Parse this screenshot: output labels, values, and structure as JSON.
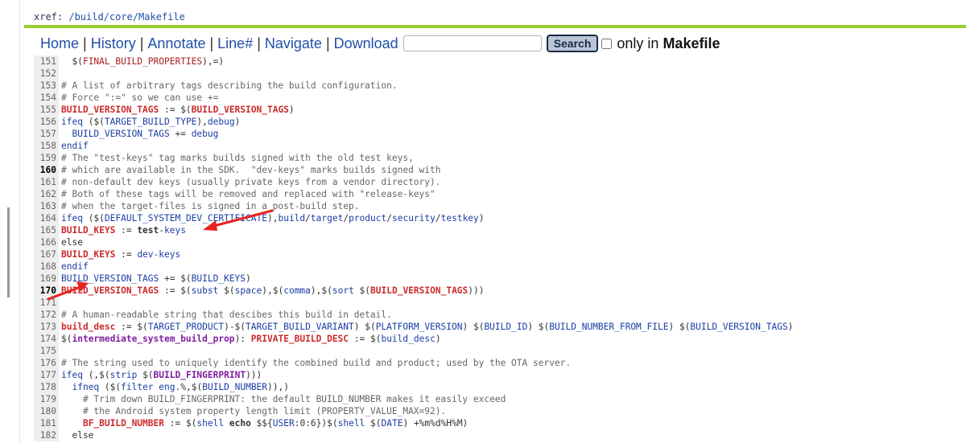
{
  "header": {
    "prefix": "xref:",
    "path": "/build/core/Makefile"
  },
  "nav": {
    "home": "Home",
    "history": "History",
    "annotate": "Annotate",
    "line": "Line#",
    "navigate": "Navigate",
    "download": "Download",
    "sep": "|",
    "search_value": "",
    "search_button": "Search",
    "only_in_prefix": "only in",
    "only_in_file": "Makefile"
  },
  "code": {
    "lines": [
      {
        "n": "151",
        "bold": false,
        "t": [
          [
            "t",
            "  $("
          ],
          [
            "r",
            "FINAL_BUILD_PROPERTIES"
          ],
          [
            "t",
            "),=)"
          ]
        ]
      },
      {
        "n": "152",
        "bold": false,
        "t": []
      },
      {
        "n": "153",
        "bold": false,
        "t": [
          [
            "c",
            "# A list of arbitrary tags describing the build configuration."
          ]
        ]
      },
      {
        "n": "154",
        "bold": false,
        "t": [
          [
            "c",
            "# Force \":=\" so we can use +="
          ]
        ]
      },
      {
        "n": "155",
        "bold": false,
        "t": [
          [
            "v",
            "BUILD_VERSION_TAGS"
          ],
          [
            "t",
            " := $("
          ],
          [
            "v",
            "BUILD_VERSION_TAGS"
          ],
          [
            "t",
            ")"
          ]
        ]
      },
      {
        "n": "156",
        "bold": false,
        "t": [
          [
            "k",
            "ifeq"
          ],
          [
            "t",
            " ($("
          ],
          [
            "b",
            "TARGET_BUILD_TYPE"
          ],
          [
            "t",
            "),"
          ],
          [
            "b",
            "debug"
          ],
          [
            "t",
            ")"
          ]
        ]
      },
      {
        "n": "157",
        "bold": false,
        "t": [
          [
            "t",
            "  "
          ],
          [
            "b",
            "BUILD_VERSION_TAGS"
          ],
          [
            "t",
            " += "
          ],
          [
            "b",
            "debug"
          ]
        ]
      },
      {
        "n": "158",
        "bold": false,
        "t": [
          [
            "k",
            "endif"
          ]
        ]
      },
      {
        "n": "159",
        "bold": false,
        "t": [
          [
            "c",
            "# The \"test-keys\" tag marks builds signed with the old test keys,"
          ]
        ]
      },
      {
        "n": "160",
        "bold": true,
        "t": [
          [
            "c",
            "# which are available in the SDK.  \"dev-keys\" marks builds signed with"
          ]
        ]
      },
      {
        "n": "161",
        "bold": false,
        "t": [
          [
            "c",
            "# non-default dev keys (usually private keys from a vendor directory)."
          ]
        ]
      },
      {
        "n": "162",
        "bold": false,
        "t": [
          [
            "c",
            "# Both of these tags will be removed and replaced with \"release-keys\""
          ]
        ]
      },
      {
        "n": "163",
        "bold": false,
        "t": [
          [
            "c",
            "# when the target-files is signed in a post-build step."
          ]
        ]
      },
      {
        "n": "164",
        "bold": false,
        "t": [
          [
            "k",
            "ifeq"
          ],
          [
            "t",
            " ($("
          ],
          [
            "b",
            "DEFAULT_SYSTEM_DEV_CERTIFICATE"
          ],
          [
            "t",
            "),"
          ],
          [
            "b",
            "build"
          ],
          [
            "t",
            "/"
          ],
          [
            "b",
            "target"
          ],
          [
            "t",
            "/"
          ],
          [
            "b",
            "product"
          ],
          [
            "t",
            "/"
          ],
          [
            "b",
            "security"
          ],
          [
            "t",
            "/"
          ],
          [
            "b",
            "testkey"
          ],
          [
            "t",
            ")"
          ]
        ]
      },
      {
        "n": "165",
        "bold": false,
        "t": [
          [
            "v",
            "BUILD_KEYS"
          ],
          [
            "t",
            " := "
          ],
          [
            "s",
            "test"
          ],
          [
            "t",
            "-"
          ],
          [
            "b",
            "keys"
          ]
        ]
      },
      {
        "n": "166",
        "bold": false,
        "t": [
          [
            "t",
            "else"
          ]
        ]
      },
      {
        "n": "167",
        "bold": false,
        "t": [
          [
            "v",
            "BUILD_KEYS"
          ],
          [
            "t",
            " := "
          ],
          [
            "b",
            "dev-keys"
          ]
        ]
      },
      {
        "n": "168",
        "bold": false,
        "t": [
          [
            "k",
            "endif"
          ]
        ]
      },
      {
        "n": "169",
        "bold": false,
        "t": [
          [
            "b",
            "BUILD_VERSION_TAGS"
          ],
          [
            "t",
            " += $("
          ],
          [
            "b",
            "BUILD_KEYS"
          ],
          [
            "t",
            ")"
          ]
        ]
      },
      {
        "n": "170",
        "bold": true,
        "t": [
          [
            "v",
            "BUILD_VERSION_TAGS"
          ],
          [
            "t",
            " := $("
          ],
          [
            "b",
            "subst"
          ],
          [
            "t",
            " $("
          ],
          [
            "b",
            "space"
          ],
          [
            "t",
            "),$("
          ],
          [
            "b",
            "comma"
          ],
          [
            "t",
            "),$("
          ],
          [
            "b",
            "sort"
          ],
          [
            "t",
            " $("
          ],
          [
            "v",
            "BUILD_VERSION_TAGS"
          ],
          [
            "t",
            ")))"
          ]
        ]
      },
      {
        "n": "171",
        "bold": false,
        "t": []
      },
      {
        "n": "172",
        "bold": false,
        "t": [
          [
            "c",
            "# A human-readable string that descibes this build in detail."
          ]
        ]
      },
      {
        "n": "173",
        "bold": false,
        "t": [
          [
            "v",
            "build_desc"
          ],
          [
            "t",
            " := $("
          ],
          [
            "b",
            "TARGET_PRODUCT"
          ],
          [
            "t",
            ")-$("
          ],
          [
            "b",
            "TARGET_BUILD_VARIANT"
          ],
          [
            "t",
            ") $("
          ],
          [
            "b",
            "PLATFORM_VERSION"
          ],
          [
            "t",
            ") $("
          ],
          [
            "b",
            "BUILD_ID"
          ],
          [
            "t",
            ") $("
          ],
          [
            "b",
            "BUILD_NUMBER_FROM_FILE"
          ],
          [
            "t",
            ") $("
          ],
          [
            "b",
            "BUILD_VERSION_TAGS"
          ],
          [
            "t",
            ")"
          ]
        ]
      },
      {
        "n": "174",
        "bold": false,
        "t": [
          [
            "t",
            "$("
          ],
          [
            "pb",
            "intermediate_system_build_prop"
          ],
          [
            "t",
            "): "
          ],
          [
            "v",
            "PRIVATE_BUILD_DESC"
          ],
          [
            "t",
            " := $("
          ],
          [
            "b",
            "build_desc"
          ],
          [
            "t",
            ")"
          ]
        ]
      },
      {
        "n": "175",
        "bold": false,
        "t": []
      },
      {
        "n": "176",
        "bold": false,
        "t": [
          [
            "c",
            "# The string used to uniquely identify the combined build and product; used by the OTA server."
          ]
        ]
      },
      {
        "n": "177",
        "bold": false,
        "t": [
          [
            "k",
            "ifeq"
          ],
          [
            "t",
            " (,$("
          ],
          [
            "b",
            "strip"
          ],
          [
            "t",
            " $("
          ],
          [
            "pb",
            "BUILD_FINGERPRINT"
          ],
          [
            "t",
            ")))"
          ]
        ]
      },
      {
        "n": "178",
        "bold": false,
        "t": [
          [
            "t",
            "  "
          ],
          [
            "k",
            "ifneq"
          ],
          [
            "t",
            " ($("
          ],
          [
            "b",
            "filter"
          ],
          [
            "t",
            " "
          ],
          [
            "b",
            "eng"
          ],
          [
            "t",
            ".%,$("
          ],
          [
            "b",
            "BUILD_NUMBER"
          ],
          [
            "t",
            ")),)"
          ]
        ]
      },
      {
        "n": "179",
        "bold": false,
        "t": [
          [
            "c",
            "    # Trim down BUILD_FINGERPRINT: the default BUILD_NUMBER makes it easily exceed"
          ]
        ]
      },
      {
        "n": "180",
        "bold": false,
        "t": [
          [
            "c",
            "    # the Android system property length limit (PROPERTY_VALUE_MAX=92)."
          ]
        ]
      },
      {
        "n": "181",
        "bold": false,
        "t": [
          [
            "t",
            "    "
          ],
          [
            "v",
            "BF_BUILD_NUMBER"
          ],
          [
            "t",
            " := $("
          ],
          [
            "b",
            "shell"
          ],
          [
            "t",
            " "
          ],
          [
            "s",
            "echo"
          ],
          [
            "t",
            " $${"
          ],
          [
            "b",
            "USER"
          ],
          [
            "t",
            ":0:6})$("
          ],
          [
            "b",
            "shell"
          ],
          [
            "t",
            " $("
          ],
          [
            "b",
            "DATE"
          ],
          [
            "t",
            ") +%m%d%H%M)"
          ]
        ]
      },
      {
        "n": "182",
        "bold": false,
        "t": [
          [
            "t",
            "  else"
          ]
        ]
      }
    ]
  },
  "colors": {
    "accent_rule": "#9acd32",
    "link": "#1f4fa8",
    "keyword": "#1a3ea5",
    "variable": "#cc2b2b",
    "annotation": "#e8231f"
  }
}
